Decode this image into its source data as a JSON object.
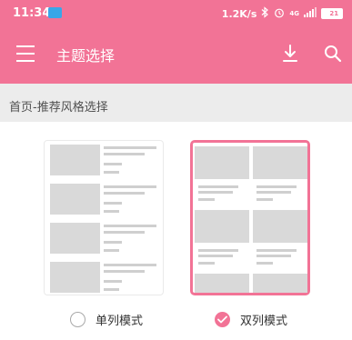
{
  "status_bar": {
    "time": "11:34",
    "net_speed": "1.2K/s",
    "network": "4G",
    "battery": "21",
    "battery_level": 0.21
  },
  "toolbar": {
    "title": "主题选择"
  },
  "section": {
    "label": "首页-推荐风格选择"
  },
  "options": [
    {
      "label": "单列模式",
      "selected": false
    },
    {
      "label": "双列模式",
      "selected": true
    }
  ],
  "colors": {
    "accent": "#f27396",
    "placeholder": "#d9d9d9",
    "section_bg": "#ececec"
  },
  "icons": [
    "menu-icon",
    "download-icon",
    "search-icon",
    "bluetooth-icon",
    "alarm-icon",
    "signal-icon",
    "battery-icon",
    "checkmark-icon"
  ]
}
